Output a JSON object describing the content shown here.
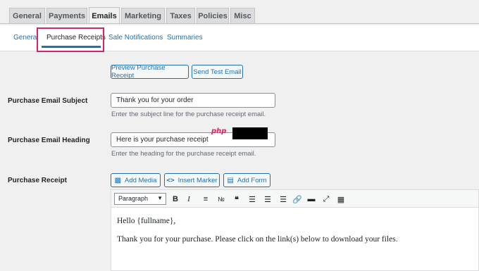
{
  "tabs": [
    {
      "label": "General"
    },
    {
      "label": "Payments"
    },
    {
      "label": "Emails",
      "active": true
    },
    {
      "label": "Marketing"
    },
    {
      "label": "Taxes"
    },
    {
      "label": "Policies"
    },
    {
      "label": "Misc"
    }
  ],
  "subnav": [
    {
      "label": "General"
    },
    {
      "label": "Purchase Receipts",
      "current": true
    },
    {
      "label": "Sale Notifications"
    },
    {
      "label": "Summaries"
    }
  ],
  "actions": {
    "preview": "Preview Purchase Receipt",
    "send_test": "Send Test Email"
  },
  "subject": {
    "label": "Purchase Email Subject",
    "value": "Thank you for your order",
    "description": "Enter the subject line for the purchase receipt email."
  },
  "heading": {
    "label": "Purchase Email Heading",
    "value": "Here is your purchase receipt",
    "description": "Enter the heading for the purchase receipt email."
  },
  "receipt": {
    "label": "Purchase Receipt",
    "add_media": "Add Media",
    "insert_marker": "Insert Marker",
    "add_form": "Add Form",
    "format_select": "Paragraph",
    "body_line1": "Hello {fullname},",
    "body_line2": "Thank you for your purchase. Please click on the link(s) below to download your files."
  },
  "overlay": {
    "logo_text": "php"
  },
  "colors": {
    "accent": "#2271b1",
    "highlight": "#d6246a"
  }
}
